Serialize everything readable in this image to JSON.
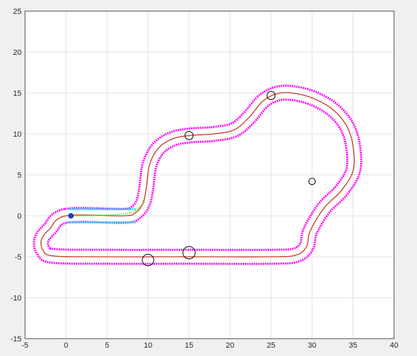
{
  "chart_data": {
    "type": "line",
    "xlim": [
      -5,
      40
    ],
    "ylim": [
      -15,
      25
    ],
    "grid": true,
    "x_ticks": [
      -5,
      0,
      5,
      10,
      15,
      20,
      25,
      30,
      35,
      40
    ],
    "y_ticks": [
      -15,
      -10,
      -5,
      0,
      5,
      10,
      15,
      20,
      25
    ],
    "x_tick_labels": [
      "-5",
      "0",
      "5",
      "10",
      "15",
      "20",
      "25",
      "30",
      "35",
      "40"
    ],
    "y_tick_labels": [
      "-15",
      "-10",
      "-5",
      "0",
      "5",
      "10",
      "15",
      "20",
      "25"
    ],
    "colors": {
      "boundary": "#ff00ff",
      "centerline": "#c0392b",
      "corridor": "#00e5ee",
      "vehicle": "#1f3fd6",
      "trajectory": "#7ed321",
      "obstacle": "#000000",
      "grid": "#e0e0e0",
      "axes_bg": "#ffffff"
    },
    "centerline": [
      [
        0,
        0
      ],
      [
        7,
        0
      ],
      [
        8.5,
        0.4
      ],
      [
        9.4,
        1.6
      ],
      [
        9.8,
        3.5
      ],
      [
        10.2,
        6.3
      ],
      [
        11.3,
        8.3
      ],
      [
        13,
        9.4
      ],
      [
        15,
        9.8
      ],
      [
        18,
        10
      ],
      [
        20.5,
        10.5
      ],
      [
        22.3,
        12
      ],
      [
        24,
        14
      ],
      [
        25.7,
        14.9
      ],
      [
        27.5,
        15
      ],
      [
        30,
        14.4
      ],
      [
        32.5,
        13
      ],
      [
        34.2,
        11
      ],
      [
        35,
        8.5
      ],
      [
        35,
        5.5
      ],
      [
        33.5,
        3
      ],
      [
        31.5,
        1
      ],
      [
        29.8,
        -1.8
      ],
      [
        29.3,
        -3.8
      ],
      [
        28,
        -4.8
      ],
      [
        25,
        -5
      ],
      [
        15,
        -5
      ],
      [
        5,
        -5
      ],
      [
        -1.5,
        -4.9
      ],
      [
        -2.8,
        -4.2
      ],
      [
        -3,
        -2.9
      ],
      [
        -2,
        -1.6
      ],
      [
        0,
        0
      ]
    ],
    "boundary_offset": 0.85,
    "corridor": {
      "x_range": [
        0.2,
        8.5
      ],
      "half_width": 0.8
    },
    "vehicle": {
      "x": 0.6,
      "y": 0
    },
    "trajectory": [
      [
        0.6,
        0
      ],
      [
        5,
        0.1
      ],
      [
        8,
        0.4
      ],
      [
        9.2,
        1.3
      ],
      [
        9.6,
        1.7
      ]
    ],
    "obstacles": [
      {
        "x": 25,
        "y": 14.7,
        "r": 0.5
      },
      {
        "x": 15,
        "y": 9.8,
        "r": 0.5
      },
      {
        "x": 30,
        "y": 4.2,
        "r": 0.4
      },
      {
        "x": 15,
        "y": -4.5,
        "r": 0.75
      },
      {
        "x": 10,
        "y": -5.4,
        "r": 0.7
      }
    ]
  }
}
